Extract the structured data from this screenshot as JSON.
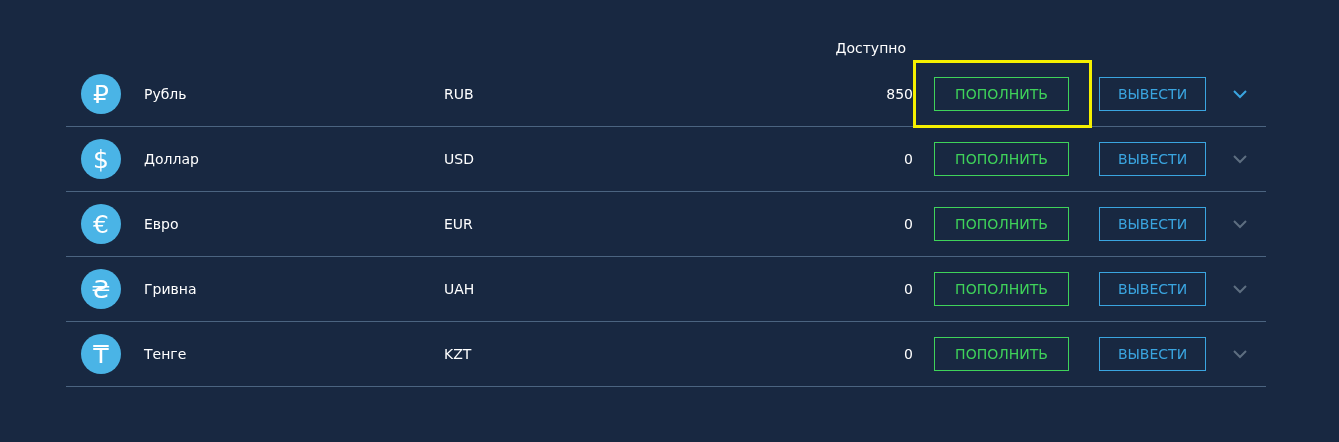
{
  "header": {
    "available_label": "Доступно"
  },
  "currencies": [
    {
      "icon": "₽",
      "name": "Рубль",
      "code": "RUB",
      "amount": "850",
      "deposit": "ПОПОЛНИТЬ",
      "withdraw": "ВЫВЕСТИ",
      "highlighted": true,
      "active": true
    },
    {
      "icon": "$",
      "name": "Доллар",
      "code": "USD",
      "amount": "0",
      "deposit": "ПОПОЛНИТЬ",
      "withdraw": "ВЫВЕСТИ",
      "highlighted": false,
      "active": false
    },
    {
      "icon": "€",
      "name": "Евро",
      "code": "EUR",
      "amount": "0",
      "deposit": "ПОПОЛНИТЬ",
      "withdraw": "ВЫВЕСТИ",
      "highlighted": false,
      "active": false
    },
    {
      "icon": "₴",
      "name": "Гривна",
      "code": "UAH",
      "amount": "0",
      "deposit": "ПОПОЛНИТЬ",
      "withdraw": "ВЫВЕСТИ",
      "highlighted": false,
      "active": false
    },
    {
      "icon": "₸",
      "name": "Тенге",
      "code": "KZT",
      "amount": "0",
      "deposit": "ПОПОЛНИТЬ",
      "withdraw": "ВЫВЕСТИ",
      "highlighted": false,
      "active": false
    }
  ]
}
